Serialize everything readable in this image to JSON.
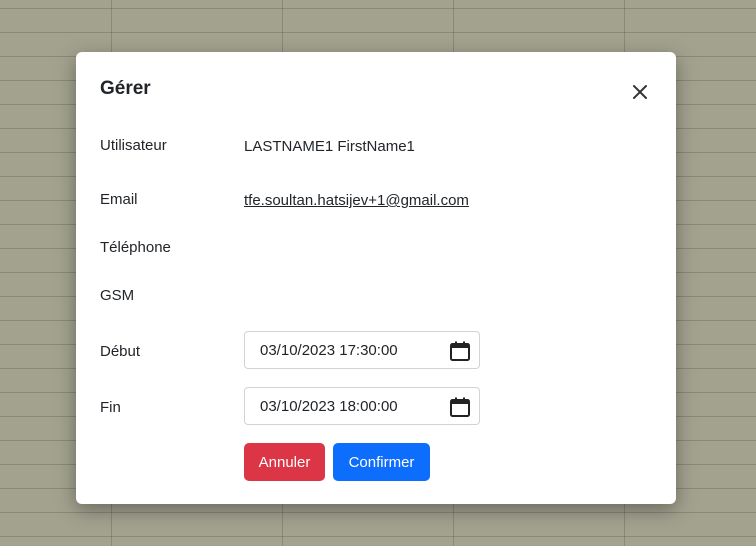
{
  "modal": {
    "title": "Gérer",
    "close_icon": "close-icon"
  },
  "fields": {
    "user_label": "Utilisateur",
    "user_value": "LASTNAME1 FirstName1",
    "email_label": "Email",
    "email_value": "tfe.soultan.hatsijev+1@gmail.com",
    "phone_label": "Téléphone",
    "gsm_label": "GSM",
    "start_label": "Début",
    "start_value": "03/10/2023 17:30:00",
    "end_label": "Fin",
    "end_value": "03/10/2023 18:00:00",
    "calendar_icon": "calendar-icon"
  },
  "actions": {
    "cancel_label": "Annuler",
    "confirm_label": "Confirmer"
  },
  "colors": {
    "cancel": "#dc3545",
    "confirm": "#0d6efd",
    "backdrop": "#a3a28f"
  }
}
